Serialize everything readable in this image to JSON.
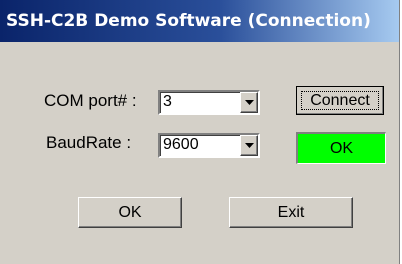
{
  "window": {
    "title": "SSH-C2B Demo Software (Connection)"
  },
  "form": {
    "com_port_label": "COM port# :",
    "com_port_value": "3",
    "baud_rate_label": "BaudRate :",
    "baud_rate_value": "9600"
  },
  "buttons": {
    "connect_label": "Connect",
    "ok_label": "OK",
    "exit_label": "Exit"
  },
  "status": {
    "text": "OK",
    "color": "#00ff00"
  },
  "icons": {
    "dropdown": "chevron-down-icon"
  }
}
